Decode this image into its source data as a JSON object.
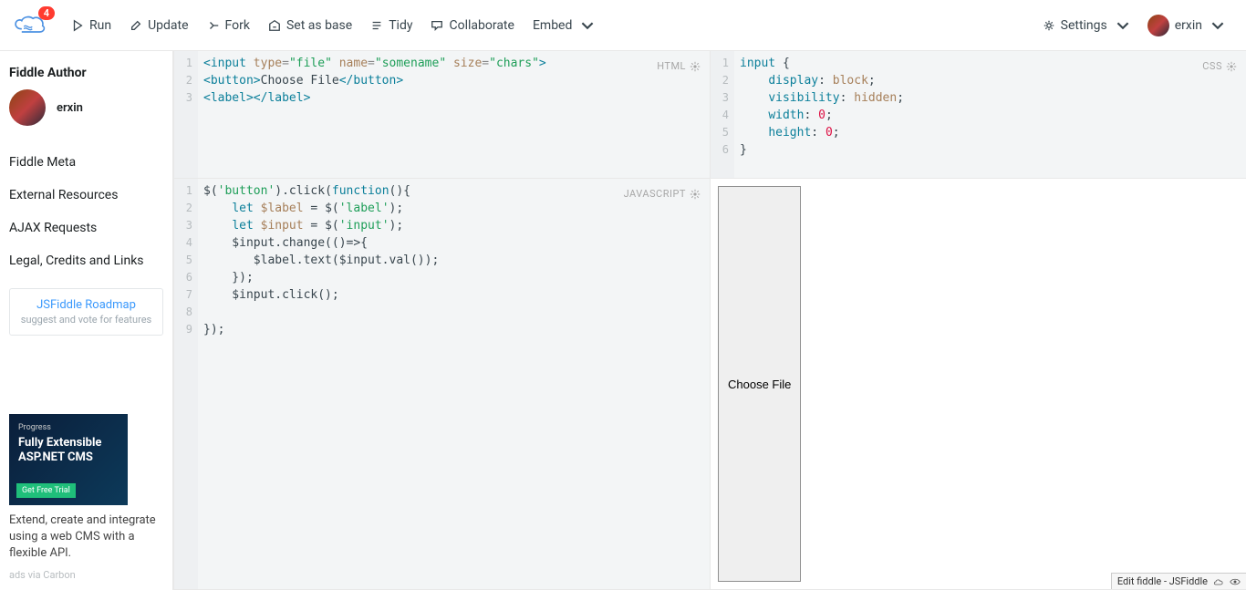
{
  "header": {
    "badge": "4",
    "run": "Run",
    "update": "Update",
    "fork": "Fork",
    "setbase": "Set as base",
    "tidy": "Tidy",
    "collab": "Collaborate",
    "embed": "Embed",
    "settings": "Settings",
    "user": "erxin"
  },
  "sidebar": {
    "author_heading": "Fiddle Author",
    "author_name": "erxin",
    "links": [
      "Fiddle Meta",
      "External Resources",
      "AJAX Requests",
      "Legal, Credits and Links"
    ],
    "roadmap_title": "JSFiddle Roadmap",
    "roadmap_sub": "suggest and vote for features",
    "ad_brand": "Progress",
    "ad_headline": "Fully Extensible ASP.NET CMS",
    "ad_cta": "Get Free Trial",
    "ad_text": "Extend, create and integrate using a web CMS with a flexible API.",
    "ad_src": "ads via Carbon"
  },
  "panes": {
    "html_label": "HTML",
    "css_label": "CSS",
    "js_label": "JAVASCRIPT",
    "result_button": "Choose File"
  },
  "code": {
    "html": {
      "lines": [
        "1",
        "2",
        "3"
      ],
      "l1": {
        "tag_open": "<input ",
        "attr1": "type",
        "eq1": "=",
        "str1": "\"file\"",
        "sp1": " ",
        "attr2": "name",
        "eq2": "=",
        "str2": "\"somename\"",
        "sp2": " ",
        "attr3": "size",
        "eq3": "=",
        "str3": "\"chars\"",
        "close": ">"
      },
      "l2": {
        "open": "<button>",
        "text": "Choose File",
        "close": "</button>"
      },
      "l3": {
        "open": "<label>",
        "close": "</label>"
      }
    },
    "css": {
      "lines": [
        "1",
        "2",
        "3",
        "4",
        "5",
        "6"
      ],
      "sel": "input ",
      "brace_o": "{",
      "p1": "display",
      "v1": "block",
      "p2": "visibility",
      "v2": "hidden",
      "p3": "width",
      "v3": "0",
      "p4": "height",
      "v4": "0",
      "brace_c": "}"
    },
    "js": {
      "lines": [
        "1",
        "2",
        "3",
        "4",
        "5",
        "6",
        "7",
        "8",
        "9"
      ],
      "l1a": "$(",
      "l1b": "'button'",
      "l1c": ").click(",
      "l1d": "function",
      "l1e": "(){",
      "l2a": "let",
      "l2b": " $label ",
      "l2c": "= $(",
      "l2d": "'label'",
      "l2e": ");",
      "l3a": "let",
      "l3b": " $input ",
      "l3c": "= $(",
      "l3d": "'input'",
      "l3e": ");",
      "l4": "    $input.change(()=>{",
      "l5": "       $label.text($input.val());",
      "l6": "    });",
      "l7": "    $input.click();",
      "l8": "",
      "l9": "});"
    }
  },
  "footer": {
    "label": "Edit fiddle - JSFiddle"
  }
}
